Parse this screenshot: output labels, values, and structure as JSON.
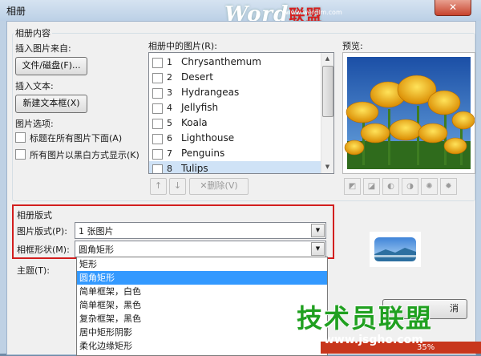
{
  "window": {
    "title": "相册",
    "close_glyph": "✕"
  },
  "watermark_top": {
    "brand_a": "Word",
    "brand_b": "联盟",
    "url": "www.wordlm.com"
  },
  "album_content": {
    "group_label": "相册内容",
    "insert_from_label": "插入图片来自:",
    "file_button": "文件/磁盘(F)...",
    "insert_text_label": "插入文本:",
    "new_textbox_button": "新建文本框(X)",
    "picture_options_label": "图片选项:",
    "option_caption": "标题在所有图片下面(A)",
    "option_bw": "所有图片以黑白方式显示(K)",
    "pictures_label": "相册中的图片(R):",
    "pictures": [
      {
        "num": "1",
        "name": "Chrysanthemum"
      },
      {
        "num": "2",
        "name": "Desert"
      },
      {
        "num": "3",
        "name": "Hydrangeas"
      },
      {
        "num": "4",
        "name": "Jellyfish"
      },
      {
        "num": "5",
        "name": "Koala"
      },
      {
        "num": "6",
        "name": "Lighthouse"
      },
      {
        "num": "7",
        "name": "Penguins"
      },
      {
        "num": "8",
        "name": "Tulips"
      }
    ],
    "up_glyph": "↑",
    "down_glyph": "↓",
    "delete_glyph": "✕",
    "delete_label": "删除(V)",
    "preview_label": "预览:"
  },
  "album_layout": {
    "group_label": "相册版式",
    "picture_layout_label": "图片版式(P):",
    "picture_layout_value": "1 张图片",
    "frame_shape_label": "相框形状(M):",
    "frame_shape_value": "圆角矩形",
    "theme_label": "主题(T):",
    "frame_options": [
      "矩形",
      "圆角矩形",
      "简单框架，白色",
      "简单框架，黑色",
      "复杂框架，黑色",
      "居中矩形阴影",
      "柔化边缘矩形"
    ],
    "frame_selected_index": 1
  },
  "watermark_bottom": {
    "text": "技术员联盟",
    "url": "www.jsgho.com"
  },
  "footer": {
    "cancel_fragment": "消",
    "percent": "35%"
  }
}
